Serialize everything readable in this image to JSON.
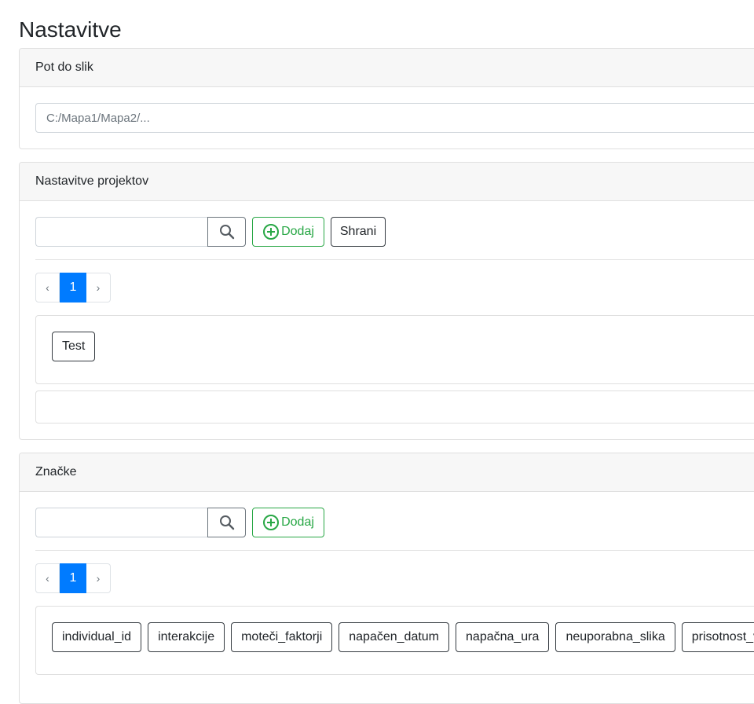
{
  "page": {
    "title": "Nastavitve"
  },
  "path_card": {
    "header": "Pot do slik",
    "input": {
      "value": "",
      "placeholder": "C:/Mapa1/Mapa2/..."
    }
  },
  "projects_card": {
    "header": "Nastavitve projektov",
    "search": {
      "value": "",
      "placeholder": ""
    },
    "add_label": "Dodaj",
    "save_label": "Shrani",
    "pagination": {
      "prev": "‹",
      "current": "1",
      "next": "›"
    },
    "items": [
      "Test"
    ]
  },
  "tags_card": {
    "header": "Značke",
    "search": {
      "value": "",
      "placeholder": ""
    },
    "add_label": "Dodaj",
    "pagination": {
      "prev": "‹",
      "current": "1",
      "next": "›"
    },
    "items": [
      "individual_id",
      "interakcije",
      "moteči_faktorji",
      "napačen_datum",
      "napačna_ura",
      "neuporabna_slika",
      "prisotnost_vo"
    ]
  },
  "colors": {
    "accent": "#007bff",
    "success": "#28a745",
    "dark": "#343a40"
  },
  "icons": {
    "search": "search-icon",
    "add": "plus-circle-icon"
  }
}
